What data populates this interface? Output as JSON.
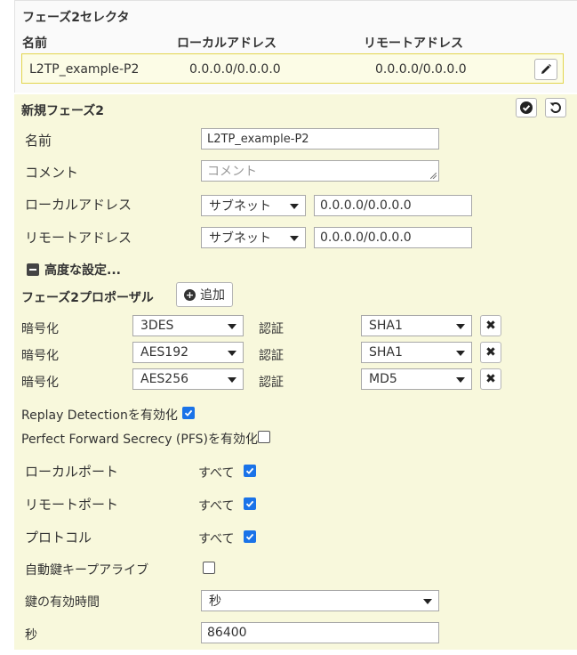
{
  "selector": {
    "title": "フェーズ2セレクタ",
    "columns": [
      "名前",
      "ローカルアドレス",
      "リモートアドレス"
    ],
    "row": {
      "name": "L2TP_example-P2",
      "local": "0.0.0.0/0.0.0.0",
      "remote": "0.0.0.0/0.0.0.0"
    },
    "edit_icon": "pencil-icon"
  },
  "panel": {
    "title": "新規フェーズ2",
    "ok_icon": "check-circle-icon",
    "revert_icon": "undo-icon",
    "name_label": "名前",
    "name_value": "L2TP_example-P2",
    "comment_label": "コメント",
    "comment_placeholder": "コメント",
    "local_label": "ローカルアドレス",
    "local_type": "サブネット",
    "local_value": "0.0.0.0/0.0.0.0",
    "remote_label": "リモートアドレス",
    "remote_type": "サブネット",
    "remote_value": "0.0.0.0/0.0.0.0",
    "advanced_label": "高度な設定...",
    "proposal_title": "フェーズ2プロポーザル",
    "add_label": "追加",
    "proposals": [
      {
        "enc_label": "暗号化",
        "enc": "3DES",
        "auth_label": "認証",
        "auth": "SHA1"
      },
      {
        "enc_label": "暗号化",
        "enc": "AES192",
        "auth_label": "認証",
        "auth": "SHA1"
      },
      {
        "enc_label": "暗号化",
        "enc": "AES256",
        "auth_label": "認証",
        "auth": "MD5"
      }
    ],
    "replay_label": "Replay Detectionを有効化",
    "replay_checked": true,
    "pfs_label": "Perfect Forward Secrecy (PFS)を有効化",
    "pfs_checked": false,
    "local_port_label": "ローカルポート",
    "local_port_all": "すべて",
    "local_port_checked": true,
    "remote_port_label": "リモートポート",
    "remote_port_all": "すべて",
    "remote_port_checked": true,
    "protocol_label": "プロトコル",
    "protocol_all": "すべて",
    "protocol_checked": true,
    "keepalive_label": "自動鍵キープアライブ",
    "keepalive_checked": false,
    "key_lifetime_label": "鍵の有効時間",
    "key_lifetime_unit": "秒",
    "seconds_label": "秒",
    "seconds_value": "86400"
  },
  "colors": {
    "panel_bg": "#f8f8dc",
    "selected_row_border": "#e3d54c",
    "checkbox_blue": "#1a73e8"
  }
}
